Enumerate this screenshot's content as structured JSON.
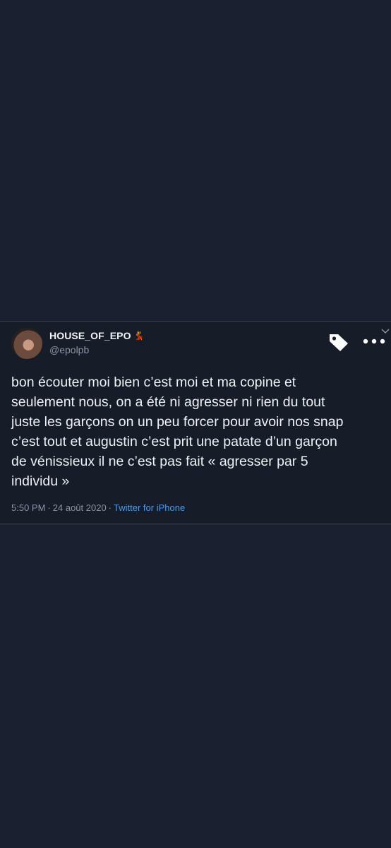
{
  "tweet": {
    "display_name": "HOUSE_OF_EPO",
    "name_emoji": "💃",
    "handle": "@epolpb",
    "text": "bon écouter moi bien c’est moi et ma copine et\nseulement nous, on a été ni agresser ni rien du tout\njuste les garçons on un peu forcer pour avoir nos snap\nc’est tout et augustin c’est prit une patate d’un garçon\nde vénissieux il ne c’est pas fait « agresser par 5\nindividu »",
    "time": "5:50 PM",
    "separator": "·",
    "date": "24 août 2020",
    "source": "Twitter for iPhone"
  },
  "icons": {
    "tag": "tag-icon",
    "more": "more-options-icon",
    "chevron": "chevron-down-icon"
  },
  "colors": {
    "background": "#1a2030",
    "card": "#161c28",
    "text": "#eef1f5",
    "muted": "#8a94a6",
    "link": "#4d9be8"
  }
}
